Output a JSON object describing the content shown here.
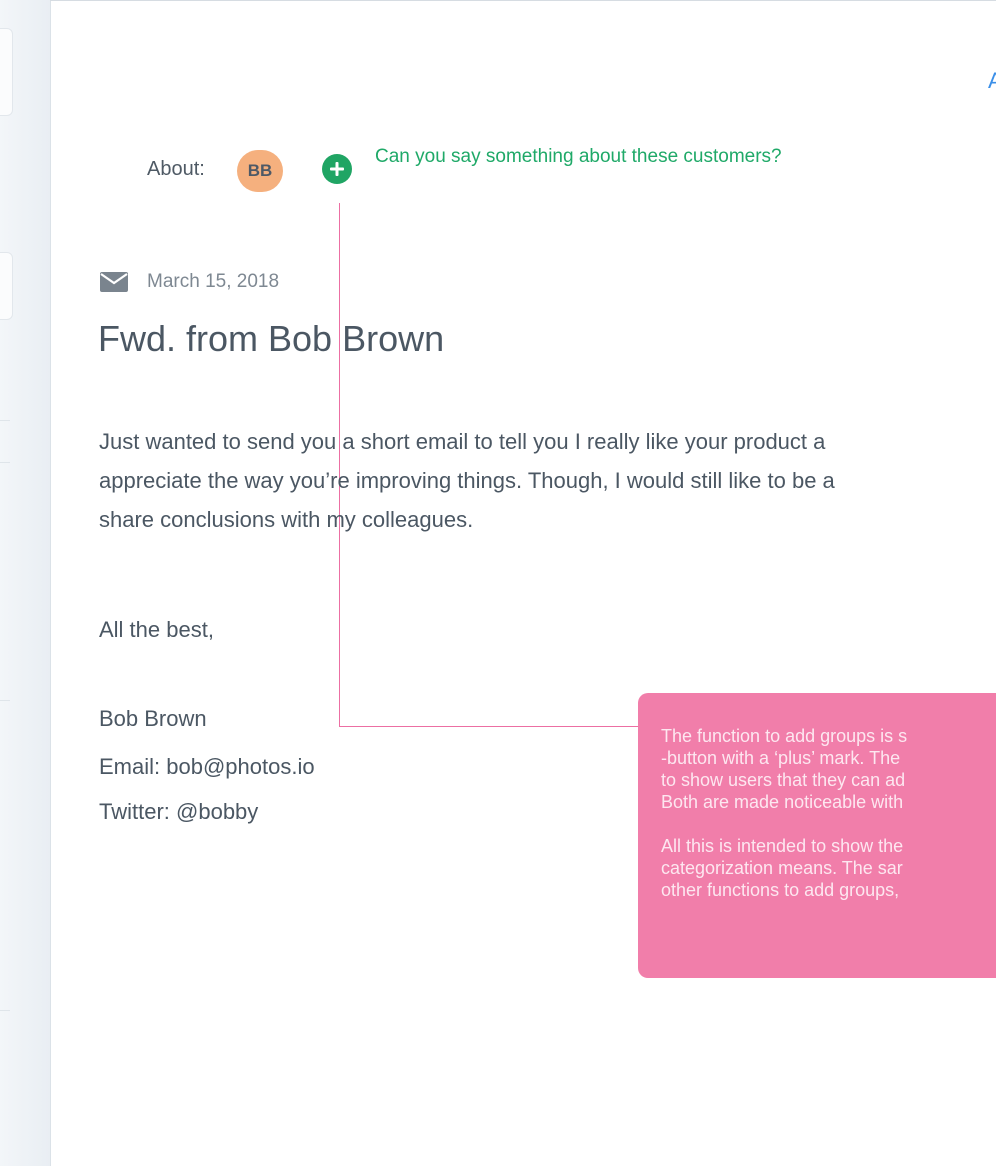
{
  "header": {
    "right_cut_text": "A"
  },
  "about": {
    "label": "About:",
    "avatar_initials": "BB",
    "prompt": "Can you say something about these customers?"
  },
  "email": {
    "date": "March 15, 2018",
    "subject": "Fwd. from Bob Brown",
    "body_lines": [
      "Just wanted to send you a short email to tell you I really like your product a",
      "appreciate the way you’re improving things. Though, I would still like to be a",
      "share conclusions with my colleagues."
    ],
    "closing": "All the best,",
    "signature": {
      "name": "Bob Brown",
      "email": "Email: bob@photos.io",
      "twitter": "Twitter: @bobby"
    }
  },
  "annotation": {
    "paragraph1_lines": [
      "The function to add groups is s",
      "-button with a ‘plus’ mark. The",
      "to show users that they can ad",
      "Both are made noticeable with"
    ],
    "paragraph2_lines": [
      "All this is intended to show the",
      "categorization means.  The sar",
      "other functions to add groups,"
    ]
  },
  "colors": {
    "accent_green": "#20a564",
    "avatar_bg": "#f5b07e",
    "annotation_pink": "#f17eaa",
    "link_blue": "#3b8fe8"
  },
  "icons": {
    "mail": "envelope-icon",
    "add": "plus-circle-icon"
  }
}
